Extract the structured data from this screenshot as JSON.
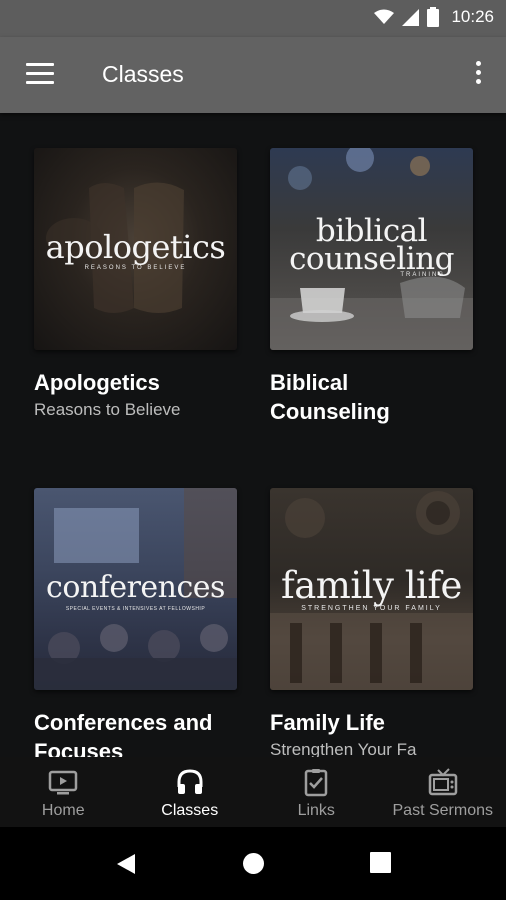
{
  "status_bar": {
    "time": "10:26"
  },
  "app_bar": {
    "title": "Classes"
  },
  "classes": [
    {
      "thumb_title": "apologetics",
      "thumb_subtitle": "Reasons to Believe",
      "title": "Apologetics",
      "subtitle": "Reasons to Believe"
    },
    {
      "thumb_title_line1": "biblical",
      "thumb_title_line2": "counseling",
      "thumb_subtitle": "Training",
      "title": "Biblical Counseling",
      "subtitle": ""
    },
    {
      "thumb_title": "conferences",
      "thumb_subtitle": "Special Events & Intensives at Fellowship",
      "title": "Conferences and Focuses",
      "subtitle": ""
    },
    {
      "thumb_title": "family life",
      "thumb_subtitle": "Strengthen Your Family",
      "title": "Family Life",
      "subtitle": "Strengthen Your Fa"
    }
  ],
  "bottom_nav": {
    "items": [
      {
        "label": "Home",
        "icon": "tv-play-icon"
      },
      {
        "label": "Classes",
        "icon": "headphones-icon",
        "active": true
      },
      {
        "label": "Links",
        "icon": "clipboard-check-icon"
      },
      {
        "label": "Past Sermons",
        "icon": "retro-tv-icon"
      }
    ]
  }
}
